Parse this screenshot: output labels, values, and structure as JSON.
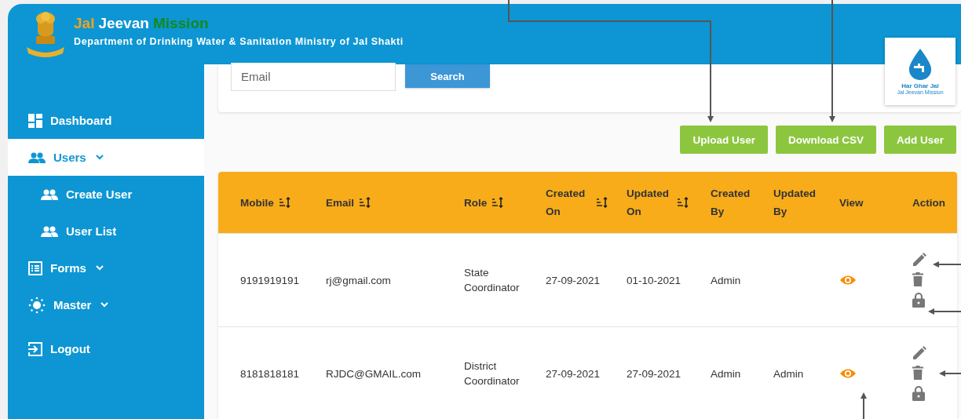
{
  "header": {
    "title_parts": [
      {
        "text": "Jal",
        "color": "#f5a31b"
      },
      {
        "text": "Jeevan",
        "color": "#ffffff"
      },
      {
        "text": "Mission",
        "color": "#138a1f"
      }
    ],
    "subtitle": "Department of Drinking Water & Sanitation Ministry of Jal Shakti"
  },
  "logo": {
    "line1": "Har Ghar Jal",
    "line2": "Jal Jeevan Mission"
  },
  "sidebar": {
    "items": [
      {
        "label": "Dashboard",
        "kind": "dashboard",
        "selected": false,
        "has_submenu": false
      },
      {
        "label": "Users",
        "kind": "users",
        "selected": true,
        "has_submenu": true,
        "children": [
          {
            "label": "Create User",
            "selected": false
          },
          {
            "label": "User List",
            "selected": false
          }
        ]
      },
      {
        "label": "Forms",
        "kind": "forms",
        "selected": false,
        "has_submenu": true
      },
      {
        "label": "Master",
        "kind": "master",
        "selected": false,
        "has_submenu": true
      },
      {
        "label": "Logout",
        "kind": "logout",
        "selected": false,
        "has_submenu": false
      }
    ]
  },
  "search": {
    "placeholder": "Email",
    "button": "Search"
  },
  "actions": [
    "Upload User",
    "Download CSV",
    "Add User"
  ],
  "table": {
    "columns": [
      {
        "label": "Mobile",
        "sortable": true
      },
      {
        "label": "Email",
        "sortable": true
      },
      {
        "label": "Role",
        "sortable": true
      },
      {
        "label": "Created On",
        "sortable": true
      },
      {
        "label": "Updated On",
        "sortable": true
      },
      {
        "label": "Created By",
        "sortable": false
      },
      {
        "label": "Updated By",
        "sortable": false
      },
      {
        "label": "View",
        "sortable": false
      },
      {
        "label": "Action",
        "sortable": false
      }
    ],
    "rows": [
      {
        "cells": [
          "9191919191",
          "rj@gmail.com",
          "State Coordinator",
          "27-09-2021",
          "01-10-2021",
          "Admin",
          null
        ]
      },
      {
        "cells": [
          "8181818181",
          "RJDC@GMAIL.com",
          "District Coordinator",
          "27-09-2021",
          "27-09-2021",
          "Admin",
          "Admin"
        ]
      }
    ]
  }
}
